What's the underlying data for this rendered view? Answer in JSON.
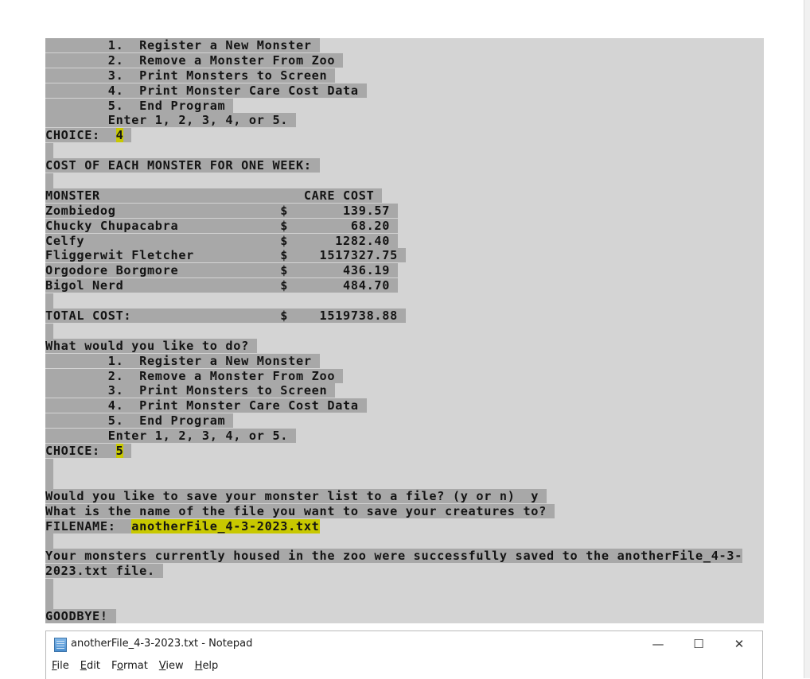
{
  "console": {
    "lines": [
      {
        "t": "        1.  Register a New Monster ",
        "s": true
      },
      {
        "t": "        2.  Remove a Monster From Zoo ",
        "s": true
      },
      {
        "t": "        3.  Print Monsters to Screen ",
        "s": true
      },
      {
        "t": "        4.  Print Monster Care Cost Data ",
        "s": true
      },
      {
        "t": "        5.  End Program ",
        "s": true
      },
      {
        "t": "        Enter 1, 2, 3, 4, or 5. ",
        "s": true
      },
      {
        "t": "CHOICE:  ",
        "s": true,
        "hi": "4",
        "after": " "
      },
      {
        "t": "",
        "bar": true
      },
      {
        "t": "COST OF EACH MONSTER FOR ONE WEEK: ",
        "s": true
      },
      {
        "t": "",
        "bar": true
      },
      {
        "t": "MONSTER                          CARE COST ",
        "s": true
      },
      {
        "t": "Zombiedog                     $       139.57 ",
        "s": true
      },
      {
        "t": "Chucky Chupacabra             $        68.20 ",
        "s": true
      },
      {
        "t": "Celfy                         $      1282.40 ",
        "s": true
      },
      {
        "t": "Fliggerwit Fletcher           $    1517327.75 ",
        "s": true
      },
      {
        "t": "Orgodore Borgmore             $       436.19 ",
        "s": true
      },
      {
        "t": "Bigol Nerd                    $       484.70 ",
        "s": true
      },
      {
        "t": "",
        "bar": true
      },
      {
        "t": "TOTAL COST:                   $    1519738.88 ",
        "s": true
      },
      {
        "t": "",
        "bar": true
      },
      {
        "t": "What would you like to do? ",
        "s": true
      },
      {
        "t": "        1.  Register a New Monster ",
        "s": true
      },
      {
        "t": "        2.  Remove a Monster From Zoo ",
        "s": true
      },
      {
        "t": "        3.  Print Monsters to Screen ",
        "s": true
      },
      {
        "t": "        4.  Print Monster Care Cost Data ",
        "s": true
      },
      {
        "t": "        5.  End Program ",
        "s": true
      },
      {
        "t": "        Enter 1, 2, 3, 4, or 5. ",
        "s": true
      },
      {
        "t": "CHOICE:  ",
        "s": true,
        "hi": "5",
        "after": " "
      },
      {
        "t": "",
        "bar": true
      },
      {
        "t": "",
        "bar": true
      },
      {
        "t": "Would you like to save your monster list to a file? (y or n)  y ",
        "s": true
      },
      {
        "t": "What is the name of the file you want to save your creatures to? ",
        "s": true
      },
      {
        "t": "FILENAME:  ",
        "s": true,
        "hi": "anotherFile_4-3-2023.txt",
        "after": ""
      },
      {
        "t": "",
        "bar": true
      },
      {
        "t": "Your monsters currently housed in the zoo were successfully saved to the anotherFile_4-3-",
        "s": true
      },
      {
        "t": "2023.txt file. ",
        "s": true
      },
      {
        "t": "",
        "bar": true
      },
      {
        "t": "",
        "bar": true
      },
      {
        "t": "GOODBYE! ",
        "s": true
      }
    ]
  },
  "notepad": {
    "title": "anotherFile_4-3-2023.txt - Notepad",
    "min_glyph": "—",
    "max_glyph": "☐",
    "close_glyph": "✕",
    "menu": [
      {
        "key": "F",
        "rest": "ile"
      },
      {
        "key": "E",
        "rest": "dit"
      },
      {
        "key": "o",
        "pre": "F",
        "rest": "rmat"
      },
      {
        "key": "V",
        "rest": "iew"
      },
      {
        "key": "H",
        "rest": "elp"
      }
    ]
  },
  "colors": {
    "console_bg": "#d4d4d4",
    "selection": "#a8a8a8",
    "highlight": "#c8c800"
  }
}
